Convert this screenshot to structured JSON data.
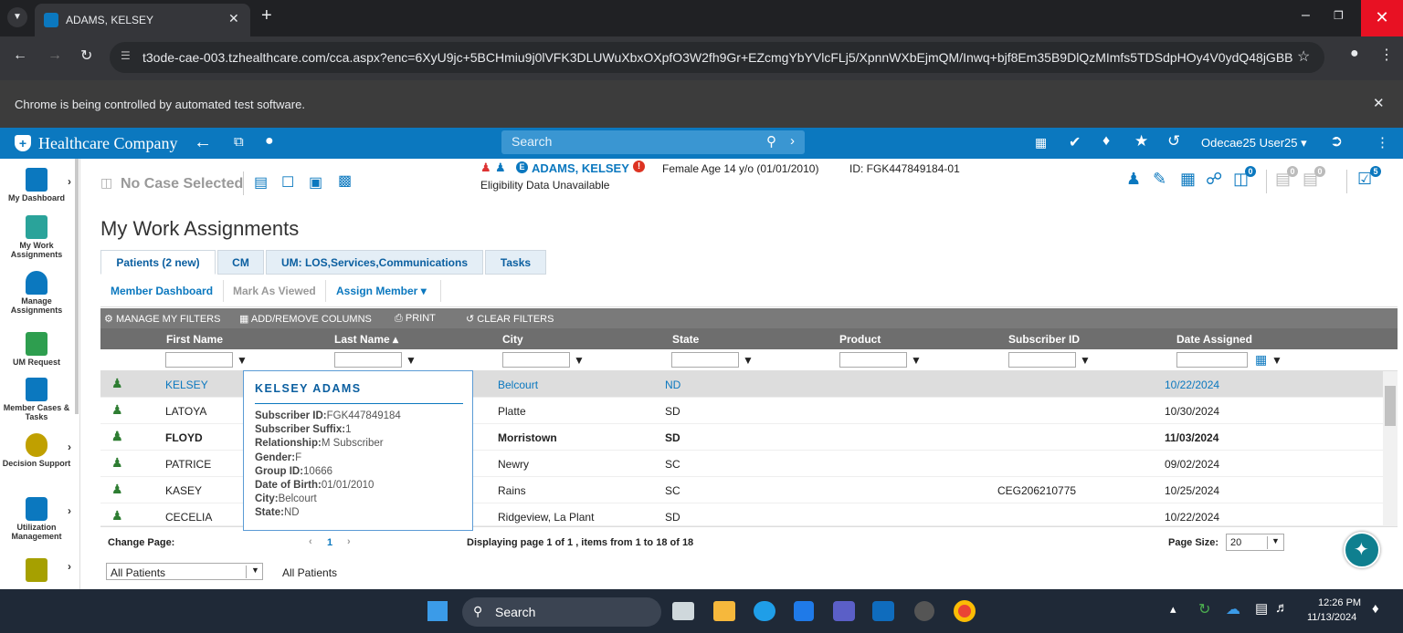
{
  "browser": {
    "tab_title": "ADAMS, KELSEY",
    "url": "t3ode-cae-003.tzhealthcare.com/cca.aspx?enc=6XyU9jc+5BCHmiu9j0lVFK3DLUWuXbxOXpfO3W2fh9Gr+EZcmgYbYVlcFLj5/XpnnWXbEjmQM/Inwq+bjf8Em35B9DlQzMImfs5TDSdpHOy4V0ydQ48jGBB7...",
    "info_message": "Chrome is being controlled by automated test software."
  },
  "app": {
    "brand": "Healthcare Company",
    "search_placeholder": "Search",
    "user_name": "Odecae25 User25"
  },
  "nav": {
    "items": [
      {
        "label": "My Dashboard",
        "icon": "dashboard-icon"
      },
      {
        "label": "My Work Assignments",
        "icon": "work-assignments-icon"
      },
      {
        "label": "Manage Assignments",
        "icon": "manage-assignments-icon"
      },
      {
        "label": "UM Request",
        "icon": "um-request-icon"
      },
      {
        "label": "Member Cases & Tasks",
        "icon": "member-cases-icon"
      },
      {
        "label": "Decision Support",
        "icon": "decision-support-icon"
      },
      {
        "label": "Utilization Management",
        "icon": "utilization-icon"
      }
    ]
  },
  "patient": {
    "no_case": "No Case Selected",
    "name": "ADAMS, KELSEY",
    "demographics": "Female Age 14 y/o (01/01/2010)",
    "id": "ID: FGK447849184-01",
    "eligibility": "Eligibility Data Unavailable",
    "badge_counts": [
      "0",
      "0",
      "0",
      "5"
    ]
  },
  "page": {
    "title": "My Work Assignments",
    "tabs": [
      "Patients (2 new)",
      "CM",
      "UM: LOS,Services,Communications",
      "Tasks"
    ],
    "subtabs": [
      "Member Dashboard",
      "Mark As Viewed",
      "Assign Member"
    ],
    "tools": [
      "MANAGE MY FILTERS",
      "ADD/REMOVE COLUMNS",
      "PRINT",
      "CLEAR FILTERS"
    ],
    "columns": [
      "First Name",
      "Last Name",
      "City",
      "State",
      "Product",
      "Subscriber ID",
      "Date Assigned"
    ]
  },
  "rows": [
    {
      "first": "KELSEY",
      "city": "Belcourt",
      "state": "ND",
      "subscriber": "",
      "date": "10/22/2024"
    },
    {
      "first": "LATOYA",
      "city": "Platte",
      "state": "SD",
      "subscriber": "",
      "date": "10/30/2024"
    },
    {
      "first": "FLOYD",
      "city": "Morristown",
      "state": "SD",
      "subscriber": "",
      "date": "11/03/2024"
    },
    {
      "first": "PATRICE",
      "city": "Newry",
      "state": "SC",
      "subscriber": "",
      "date": "09/02/2024"
    },
    {
      "first": "KASEY",
      "city": "Rains",
      "state": "SC",
      "subscriber": "CEG206210775",
      "date": "10/25/2024"
    },
    {
      "first": "CECELIA",
      "city": "Ridgeview, La Plant",
      "state": "SD",
      "subscriber": "",
      "date": "10/22/2024"
    }
  ],
  "pager": {
    "change_page": "Change Page:",
    "page_num": "1",
    "display": "Displaying page 1 of 1 , items from 1 to 18 of 18",
    "page_size_label": "Page Size:",
    "page_size": "20"
  },
  "bottom": {
    "select_value": "All Patients",
    "label": "All Patients"
  },
  "popup": {
    "title": "KELSEY ADAMS",
    "fields": [
      {
        "k": "Subscriber ID:",
        "v": "FGK447849184"
      },
      {
        "k": "Subscriber Suffix:",
        "v": "1"
      },
      {
        "k": "Relationship:",
        "v": "M Subscriber"
      },
      {
        "k": "Gender:",
        "v": "F"
      },
      {
        "k": "Group ID:",
        "v": "10666"
      },
      {
        "k": "Date of Birth:",
        "v": "01/01/2010"
      },
      {
        "k": "City:",
        "v": "Belcourt"
      },
      {
        "k": "State:",
        "v": "ND"
      }
    ]
  },
  "taskbar": {
    "search": "Search",
    "time": "12:26 PM",
    "date": "11/13/2024"
  },
  "colors": {
    "brand_blue": "#0b78bf",
    "grid_header": "#6e6e6e",
    "assigned_icon": "#2e7d32",
    "fab": "#0f7f8f"
  }
}
